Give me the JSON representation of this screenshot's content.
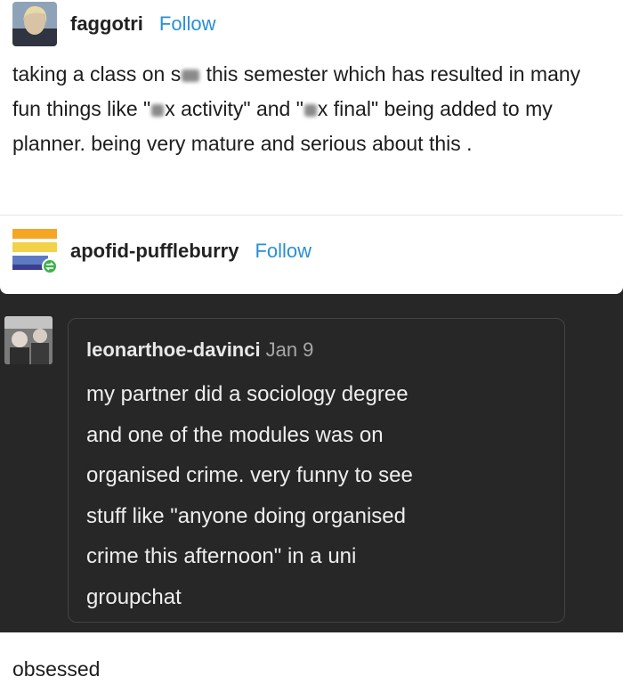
{
  "post1": {
    "username": "faggotri",
    "follow": "Follow",
    "text_a": "taking a class on s",
    "text_b": " this semester which has resulted in many fun things like \"",
    "text_c": "x activity\" and \"",
    "text_d": "x final\" being added to my planner. being very mature and serious about this ."
  },
  "post2": {
    "username": "apofid-puffleburry",
    "follow": "Follow"
  },
  "quote": {
    "username": "leonarthoe-davinci",
    "date": "Jan 9",
    "lines": [
      "my partner did a sociology degree",
      "and one of the modules was on",
      "organised crime. very funny to see",
      "stuff like \"anyone doing organised",
      "crime this afternoon\" in a uni",
      "groupchat"
    ]
  },
  "reply": {
    "text": "obsessed"
  },
  "colors": {
    "follow": "#2a8fd6",
    "dark_bg": "#272727"
  }
}
